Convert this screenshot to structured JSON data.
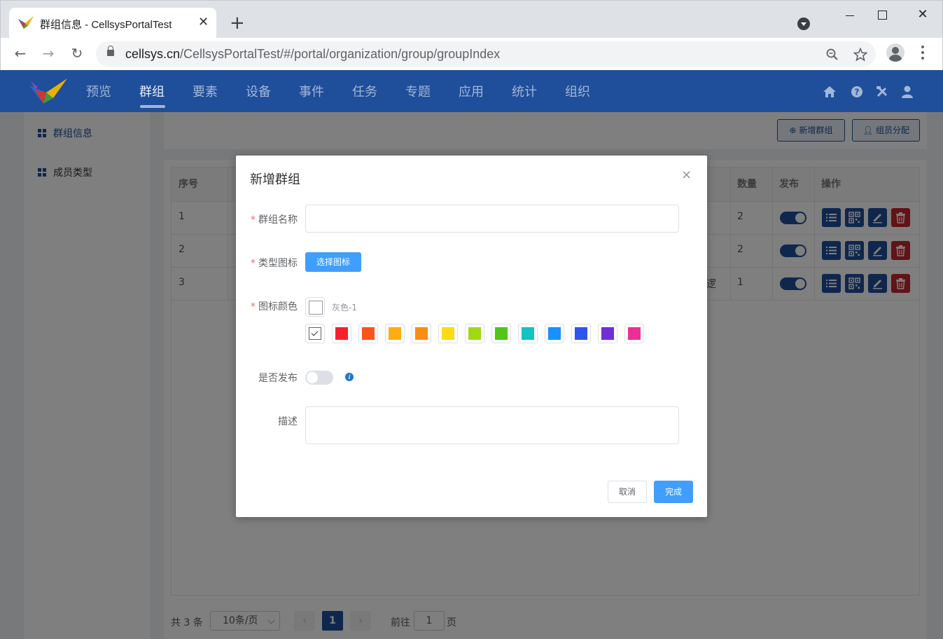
{
  "browser": {
    "tab_title": "群组信息 - CellsysPortalTest",
    "tab_close": "✕",
    "new_tab": "+",
    "url_host": "cellsys.cn",
    "url_path": "/CellsysPortalTest/#/portal/organization/group/groupIndex",
    "back": "←",
    "forward": "→",
    "reload": "↻",
    "window_close": "✕"
  },
  "app_nav": {
    "items": [
      "预览",
      "群组",
      "要素",
      "设备",
      "事件",
      "任务",
      "专题",
      "应用",
      "统计",
      "组织"
    ],
    "active": "群组",
    "icons": [
      "home-icon",
      "help-icon",
      "tools-icon",
      "user-icon"
    ]
  },
  "sidebar": {
    "items": [
      {
        "label": "群组信息",
        "icon": "grid-icon",
        "active": true
      },
      {
        "label": "成员类型",
        "icon": "grid-icon",
        "active": false
      }
    ]
  },
  "toolbar": {
    "add_group_label": "新增群组",
    "add_group_icon": "plus-circle-icon",
    "assign_label": "组员分配",
    "assign_icon": "user-icon"
  },
  "table": {
    "columns": {
      "index": "序号",
      "count": "数量",
      "publish": "发布",
      "ops": "操作"
    },
    "rows": [
      {
        "index": "1",
        "count": "2",
        "published": true,
        "partial": ""
      },
      {
        "index": "2",
        "count": "2",
        "published": true,
        "partial": ""
      },
      {
        "index": "3",
        "count": "1",
        "published": true,
        "partial": "逻"
      }
    ],
    "op_icons": [
      "list-icon",
      "qrcode-icon",
      "edit-icon",
      "delete-icon"
    ]
  },
  "pagination": {
    "total": "共 3 条",
    "page_size": "10条/页",
    "prev": "‹",
    "next": "›",
    "current": "1",
    "goto_prefix": "前往",
    "goto_value": "1",
    "goto_suffix": "页"
  },
  "dialog": {
    "title": "新增群组",
    "close": "×",
    "required_mark": "*",
    "name_label": "群组名称",
    "name_value": "",
    "type_icon_label": "类型图标",
    "choose_icon_button": "选择图标",
    "icon_color_label": "图标颜色",
    "current_color_name": "灰色-1",
    "palette": [
      "#ffffff",
      "#f5222d",
      "#fa541c",
      "#faad14",
      "#fa8c16",
      "#fadb14",
      "#a0d911",
      "#52c41a",
      "#13c2c2",
      "#1890ff",
      "#2f54eb",
      "#722ed1",
      "#eb2f96"
    ],
    "selected_color": "#ffffff",
    "publish_label": "是否发布",
    "publish_on": false,
    "info_icon": "i",
    "desc_label": "描述",
    "desc_value": "",
    "cancel_button": "取消",
    "confirm_button": "完成"
  },
  "colors": {
    "brand_blue": "#1f4e9a",
    "primary": "#409eff",
    "danger": "#c4272f"
  }
}
